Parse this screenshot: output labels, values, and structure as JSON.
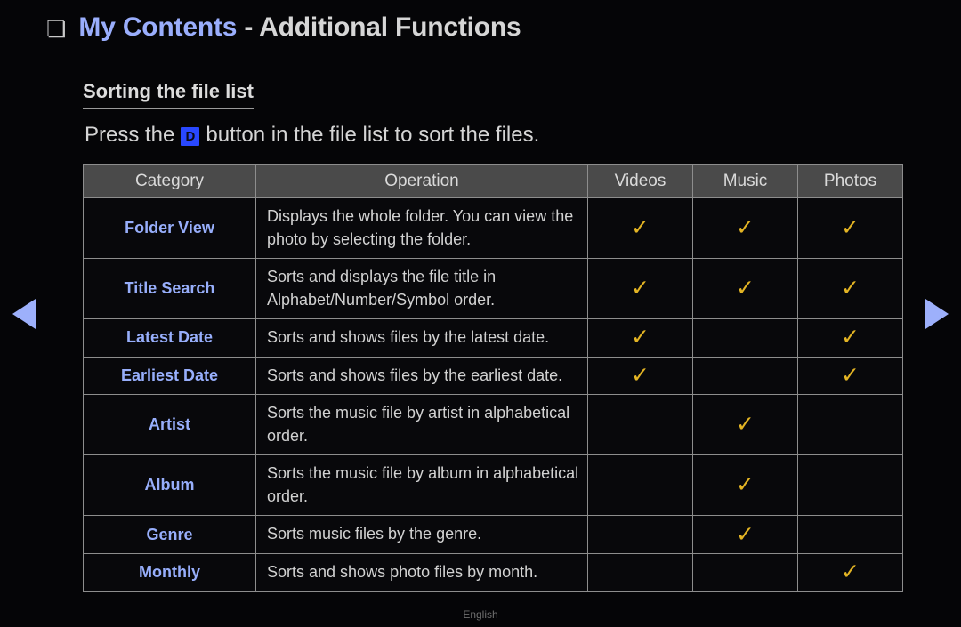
{
  "header": {
    "bullet_icon": "double-square-bullet",
    "title_accent": "My Contents",
    "title_rest": " - Additional Functions"
  },
  "section": {
    "heading": "Sorting the file list",
    "instruction_prefix": "Press the",
    "instruction_key": "D",
    "instruction_suffix": "button in the file list to sort the files."
  },
  "table": {
    "columns": [
      "Category",
      "Operation",
      "Videos",
      "Music",
      "Photos"
    ],
    "check_glyph": "✓",
    "rows": [
      {
        "category": "Folder View",
        "operation": "Displays the whole folder. You can view the photo by selecting the folder.",
        "videos": "✓",
        "music": "✓",
        "photos": "✓",
        "size": "tall"
      },
      {
        "category": "Title Search",
        "operation": "Sorts and displays the file title in Alphabet/Number/Symbol order.",
        "videos": "✓",
        "music": "✓",
        "photos": "✓",
        "size": "tall"
      },
      {
        "category": "Latest Date",
        "operation": "Sorts and shows files by the latest date.",
        "videos": "✓",
        "music": "",
        "photos": "✓",
        "size": "short"
      },
      {
        "category": "Earliest Date",
        "operation": "Sorts and shows files by the earliest date.",
        "videos": "✓",
        "music": "",
        "photos": "✓",
        "size": "short"
      },
      {
        "category": "Artist",
        "operation": "Sorts the music file by artist in alphabetical order.",
        "videos": "",
        "music": "✓",
        "photos": "",
        "size": "tall"
      },
      {
        "category": "Album",
        "operation": "Sorts the music file by album in alphabetical order.",
        "videos": "",
        "music": "✓",
        "photos": "",
        "size": "tall"
      },
      {
        "category": "Genre",
        "operation": "Sorts music files by the genre.",
        "videos": "",
        "music": "✓",
        "photos": "",
        "size": "short"
      },
      {
        "category": "Monthly",
        "operation": "Sorts and shows photo files by month.",
        "videos": "",
        "music": "",
        "photos": "✓",
        "size": "short"
      }
    ]
  },
  "navigation": {
    "prev_icon": "triangle-left-icon",
    "next_icon": "triangle-right-icon"
  },
  "footer": {
    "language": "English"
  },
  "colors": {
    "background": "#050507",
    "accent_blue": "#9aaefc",
    "key_badge_blue": "#2948ff",
    "check_gold": "#e3b424",
    "header_row_gray": "#4a4a4a",
    "border_gray": "#8d8d8d"
  }
}
